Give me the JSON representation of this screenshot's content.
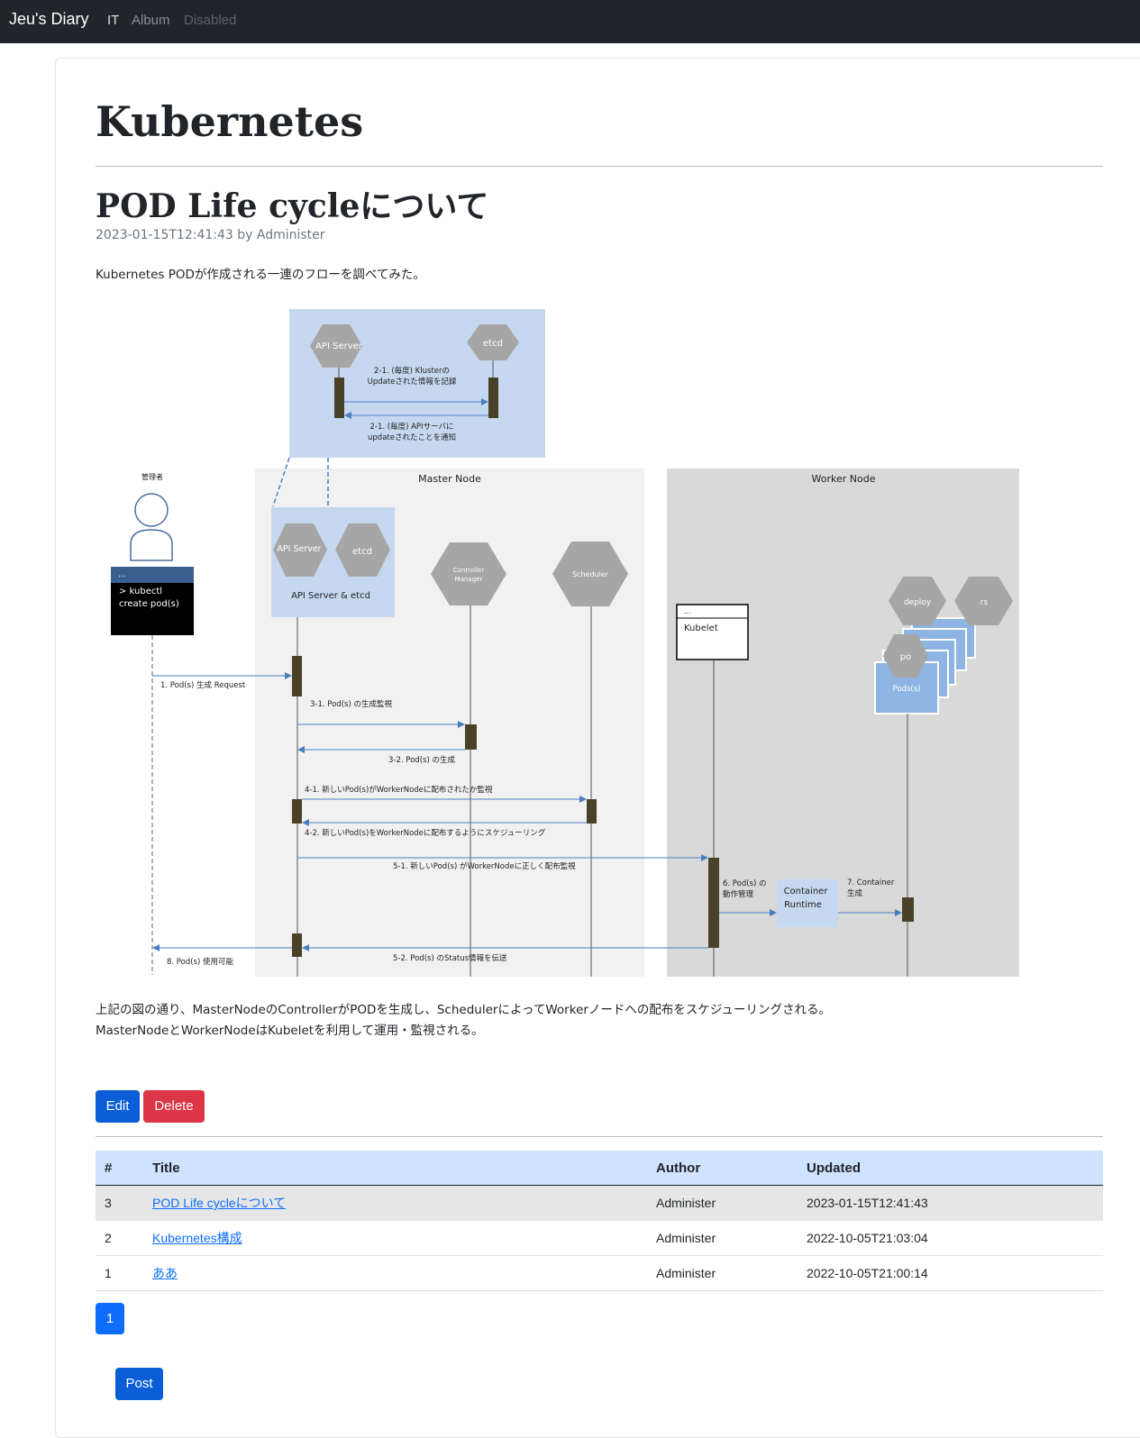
{
  "navbar": {
    "brand": "Jeu's Diary",
    "links": [
      {
        "label": "IT",
        "state": "active"
      },
      {
        "label": "Album",
        "state": "normal"
      },
      {
        "label": "Disabled",
        "state": "disabled"
      }
    ]
  },
  "category_title": "Kubernetes",
  "post": {
    "title": "POD Life cycleについて",
    "timestamp": "2023-01-15T12:41:43",
    "by": "by",
    "author": "Administer",
    "intro": "Kubernetes PODが作成される一連のフローを調べてみた。",
    "outro_line1": "上記の図の通り、MasterNodeのControllerがPODを生成し、SchedulerによってWorkerノードへの配布をスケジューリングされる。",
    "outro_line2": "MasterNodeとWorkerNodeはKubeletを利用して運用・監視される。"
  },
  "diagram": {
    "top_api": "API Server",
    "top_etcd": "etcd",
    "top_msg1a": "2-1. (毎度) Klusterの",
    "top_msg1b": "Updateされた情報を記録",
    "top_msg2a": "2-1. (毎度) APIサーバに",
    "top_msg2b": "updateされたことを通知",
    "admin_label": "管理者",
    "terminal_title": "...",
    "terminal_line1": "> kubectl",
    "terminal_line2": "create pod(s)",
    "master_node": "Master Node",
    "worker_node": "Worker Node",
    "api_server": "API Server",
    "etcd": "etcd",
    "api_etcd_label": "API Server & etcd",
    "controller_a": "Controller",
    "controller_b": "Manager",
    "scheduler": "Scheduler",
    "kubelet_title": "...",
    "kubelet": "Kubelet",
    "deploy": "deploy",
    "rs": "rs",
    "po": "po",
    "pods": "Pods(s)",
    "msg1": "1. Pod(s) 生成 Request",
    "msg31": "3-1. Pod(s) の生成監視",
    "msg32": "3-2. Pod(s) の生成",
    "msg41": "4-1. 新しいPod(s)がWorkerNodeに配布されたか監視",
    "msg42": "4-2. 新しいPod(s)をWorkerNodeに配布するようにスケジューリング",
    "msg51": "5-1. 新しいPod(s) がWorkerNodeに正しく配布監視",
    "msg6a": "6. Pod(s) の",
    "msg6b": "動作管理",
    "runtime_a": "Container",
    "runtime_b": "Runtime",
    "msg7a": "7. Container",
    "msg7b": "生成",
    "msg52": "5-2. Pod(s) のStatus情報を伝送",
    "msg8": "8. Pod(s) 使用可能"
  },
  "actions": {
    "edit": "Edit",
    "delete": "Delete",
    "post": "Post"
  },
  "table": {
    "headers": [
      "#",
      "Title",
      "Author",
      "Updated"
    ],
    "rows": [
      {
        "num": "3",
        "title": "POD Life cycleについて",
        "author": "Administer",
        "updated": "2023-01-15T12:41:43"
      },
      {
        "num": "2",
        "title": "Kubernetes構成",
        "author": "Administer",
        "updated": "2022-10-05T21:03:04"
      },
      {
        "num": "1",
        "title": "ああ",
        "author": "Administer",
        "updated": "2022-10-05T21:00:14"
      }
    ]
  },
  "pagination": {
    "current": "1"
  },
  "colors": {
    "navbar_bg": "#212529",
    "primary": "#0d6efd",
    "edit_btn": "#0b5ed7",
    "danger": "#dc3545",
    "table_header_bg": "#cfe2ff",
    "selected_row_bg": "#e6e6e6"
  }
}
